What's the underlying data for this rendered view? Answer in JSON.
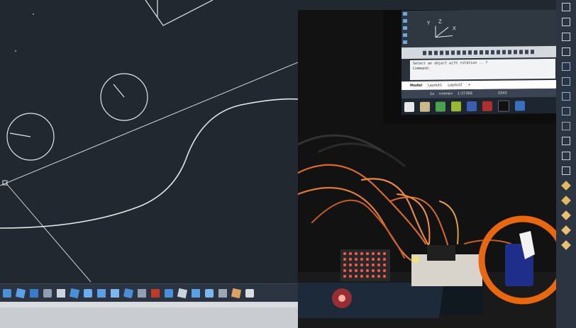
{
  "window": {
    "background_color": "#212830",
    "line_color": "#e6e6e6"
  },
  "bottom_toolbar": {
    "icons": [
      "box-3d-icon",
      "union-icon",
      "subtract-icon",
      "intersect-icon",
      "checker-icon",
      "fillet-edge-icon",
      "extrude-icon",
      "presspull-icon",
      "solid-edit-icon",
      "wireframe-box-icon",
      "revolve-icon",
      "sweep-icon",
      "loft-icon",
      "slice-icon",
      "thicken-icon",
      "align-3d-icon",
      "mirror-3d-icon",
      "render-icon",
      "material-icon"
    ]
  },
  "photo": {
    "monitor": {
      "axis_labels": {
        "y": "Y",
        "z": "Z",
        "x": "X"
      },
      "command_line": {
        "prompt": "Select an object with rotation .. ?",
        "label": "Command:"
      },
      "layout_tabs": [
        "Model",
        "Layout1",
        "Layout2",
        "+"
      ],
      "status": {
        "scale": "1x",
        "layer": "<none>",
        "ratio": "1:37366",
        "coord": "3243"
      }
    },
    "highlight_circle_color": "#e8670f"
  },
  "right_palette": {
    "icons": [
      "dimension-icon",
      "angle-icon",
      "grid-icon",
      "hatch-icon",
      "split-icon",
      "split-icon",
      "split-icon",
      "split-icon",
      "ruler-icon",
      "cursor-icon",
      "table-icon",
      "table-icon",
      "block-icon",
      "edit-icon",
      "diamond-icon",
      "diamond-icon",
      "sweep-icon"
    ]
  }
}
